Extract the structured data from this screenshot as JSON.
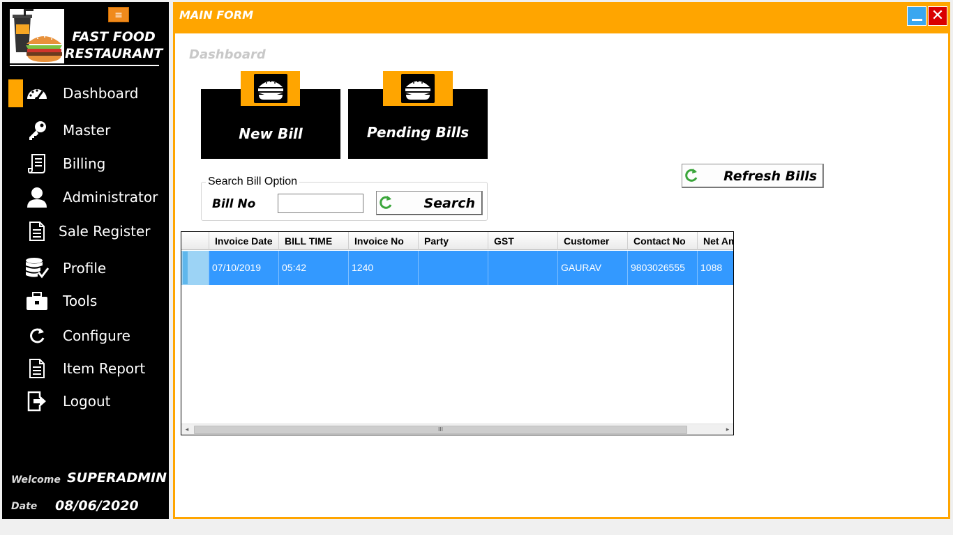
{
  "app": {
    "brand_line1": "FAST FOOD",
    "brand_line2": "RESTAURANT",
    "menu_toggle_glyph": "≡"
  },
  "sidebar": {
    "items": [
      {
        "label": "Dashboard",
        "icon": "speedometer-icon",
        "active": true
      },
      {
        "label": "Master",
        "icon": "key-icon"
      },
      {
        "label": "Billing",
        "icon": "receipt-icon"
      },
      {
        "label": "Administrator",
        "icon": "user-icon"
      },
      {
        "label": "Sale Register",
        "icon": "document-icon"
      },
      {
        "label": "Profile",
        "icon": "database-check-icon"
      },
      {
        "label": "Tools",
        "icon": "toolbox-icon"
      },
      {
        "label": "Configure",
        "icon": "refresh-icon"
      },
      {
        "label": "Item Report",
        "icon": "document-icon"
      },
      {
        "label": "Logout",
        "icon": "logout-icon"
      }
    ],
    "welcome_label": "Welcome",
    "username": "SUPERADMIN",
    "date_label": "Date",
    "date_value": "08/06/2020"
  },
  "window": {
    "title": "MAIN FORM",
    "close_glyph": "✕"
  },
  "main": {
    "section_title": "Dashboard",
    "tiles": [
      {
        "label": "New Bill",
        "icon": "burger-icon"
      },
      {
        "label": "Pending Bills",
        "icon": "burger-icon"
      }
    ],
    "refresh_label": "Refresh Bills",
    "search_group": {
      "title": "Search Bill Option",
      "bill_no_label": "Bill No",
      "bill_no_value": "",
      "search_label": "Search"
    }
  },
  "grid": {
    "columns": [
      "Invoice Date",
      "BILL TIME",
      "Invoice No",
      "Party",
      "GST",
      "Customer",
      "Contact No",
      "Net Amount"
    ],
    "rows": [
      [
        "07/10/2019",
        "05:42",
        "1240",
        "",
        "",
        "GAURAV",
        "9803026555",
        "1088"
      ]
    ],
    "scroll_left": "◂",
    "scroll_right": "▸",
    "scroll_grip": "III"
  },
  "colors": {
    "accent": "#ffa500",
    "sidebar_bg": "#000000",
    "selection": "#3399ff",
    "refresh_green": "#3aa53a"
  }
}
